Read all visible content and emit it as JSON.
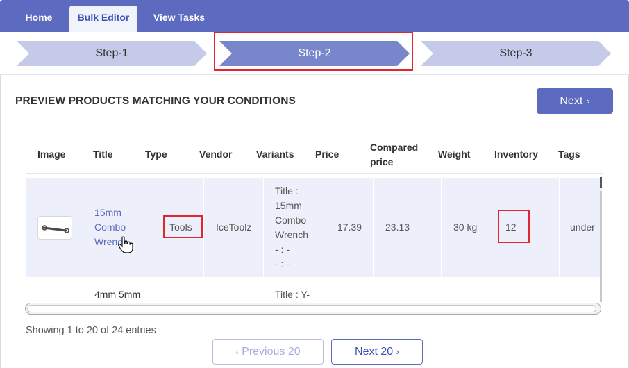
{
  "tabs": [
    {
      "label": "Home",
      "active": false
    },
    {
      "label": "Bulk Editor",
      "active": true
    },
    {
      "label": "View Tasks",
      "active": false
    }
  ],
  "steps": [
    {
      "label": "Step-1",
      "active": false
    },
    {
      "label": "Step-2",
      "active": true
    },
    {
      "label": "Step-3",
      "active": false
    }
  ],
  "page": {
    "heading": "PREVIEW PRODUCTS MATCHING YOUR CONDITIONS",
    "next_label": "Next",
    "next_icon": "chevron-right-icon"
  },
  "table": {
    "columns": [
      "Image",
      "Title",
      "Type",
      "Vendor",
      "Variants",
      "Price",
      "Compared price",
      "Weight",
      "Inventory",
      "Tags"
    ],
    "columns_wrapped": {
      "compared_line1": "Compared",
      "compared_line2": "price"
    },
    "rows": [
      {
        "image": "wrench-thumbnail",
        "title_lines": [
          "15mm",
          "Combo",
          "Wrench"
        ],
        "type": "Tools",
        "vendor": "IceToolz",
        "variants_lines": [
          "Title :",
          "15mm",
          "Combo",
          "Wrench",
          "- : -",
          "- : -"
        ],
        "price": "17.39",
        "compared_price": "23.13",
        "weight": "30 kg",
        "inventory": "12",
        "tags": "under"
      },
      {
        "image": "",
        "title_lines": [
          "4mm 5mm"
        ],
        "type": "",
        "vendor": "",
        "variants_lines": [
          "Title : Y-"
        ],
        "price": "",
        "compared_price": "",
        "weight": "",
        "inventory": "",
        "tags": ""
      }
    ]
  },
  "footer": {
    "entries_text": "Showing 1 to 20 of 24 entries",
    "prev_label": "Previous 20",
    "next_label": "Next 20"
  },
  "colors": {
    "primary": "#5c6bc0",
    "highlight_red": "#e0262e",
    "row_selected_bg": "#edf0fb",
    "step_inactive": "#c5cae9",
    "step_active": "#7986cb"
  }
}
